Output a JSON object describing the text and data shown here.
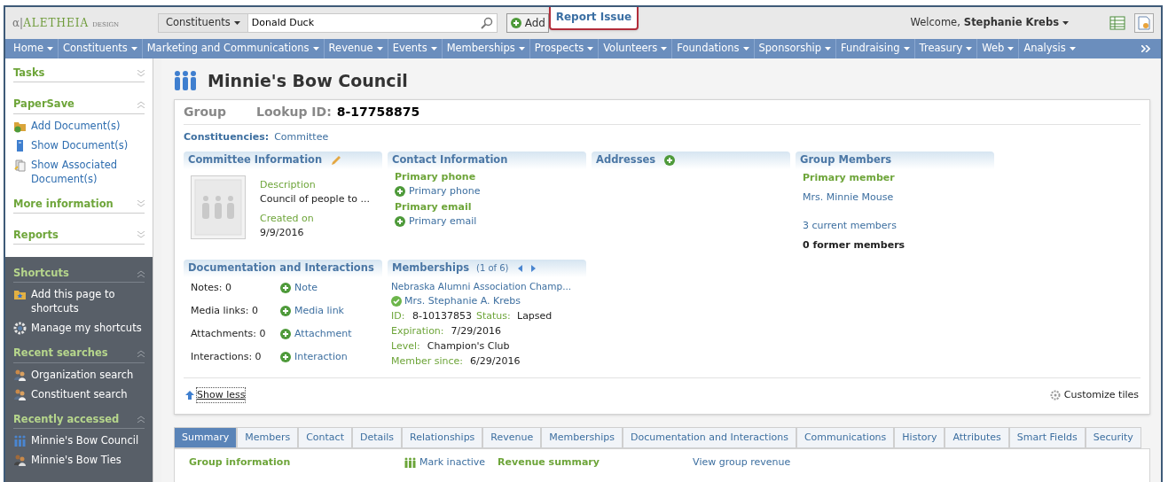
{
  "header": {
    "logo_mark": "α|",
    "logo_name": "ALETHEIA",
    "logo_tag": "DESIGN",
    "search_scope": "Constituents",
    "search_value": "Donald Duck",
    "add_button": "Add",
    "report_issue": "Report Issue",
    "welcome": "Welcome,",
    "user": "Stephanie Krebs"
  },
  "nav": [
    "Home",
    "Constituents",
    "Marketing and Communications",
    "Revenue",
    "Events",
    "Memberships",
    "Prospects",
    "Volunteers",
    "Foundations",
    "Sponsorship",
    "Fundraising",
    "Treasury",
    "Web",
    "Analysis"
  ],
  "sidebar": [
    {
      "title": "Tasks",
      "kind": "light",
      "expanded": false
    },
    {
      "title": "PaperSave",
      "kind": "light",
      "expanded": true,
      "items": [
        {
          "label": "Add Document(s)",
          "kind": "add"
        },
        {
          "label": "Show Document(s)",
          "kind": "document"
        },
        {
          "label": "Show Associated Document(s)",
          "kind": "documents"
        }
      ]
    },
    {
      "title": "More information",
      "kind": "light",
      "expanded": false
    },
    {
      "title": "Reports",
      "kind": "light",
      "expanded": false
    },
    {
      "title": "Shortcuts",
      "kind": "dark",
      "expanded": true,
      "items": [
        {
          "label": "Add this page to shortcuts",
          "kind": "shortcut"
        },
        {
          "label": "Manage my shortcuts",
          "kind": "settings"
        }
      ]
    },
    {
      "title": "Recent searches",
      "kind": "dark",
      "expanded": true,
      "items": [
        {
          "label": "Organization search",
          "kind": "search"
        },
        {
          "label": "Constituent search",
          "kind": "search"
        }
      ]
    },
    {
      "title": "Recently accessed",
      "kind": "dark",
      "expanded": true,
      "items": [
        {
          "label": "Minnie's Bow Council",
          "kind": "group"
        },
        {
          "label": "Minnie's Bow Ties",
          "kind": "organization"
        }
      ]
    }
  ],
  "record": {
    "title": "Minnie's Bow Council",
    "type": "Group",
    "lookup_label": "Lookup ID:",
    "lookup_id": "8-17758875",
    "constituencies_label": "Constituencies:",
    "constituencies": "Committee"
  },
  "tiles": [
    {
      "kind": "committee",
      "title": "Committee Information",
      "editable": true,
      "description_label": "Description",
      "description": "Council of people to ...",
      "created_label": "Created on",
      "created": "9/9/2016"
    },
    {
      "kind": "contact",
      "title": "Contact Information",
      "rows": [
        {
          "label": "Primary phone",
          "action": "Primary phone"
        },
        {
          "label": "Primary email",
          "action": "Primary email"
        }
      ]
    },
    {
      "kind": "addresses",
      "title": "Addresses"
    },
    {
      "kind": "members",
      "title": "Group Members",
      "primary_label": "Primary member",
      "primary": "Mrs. Minnie Mouse",
      "current": "3 current members",
      "former": "0 former members"
    },
    {
      "kind": "documentation",
      "title": "Documentation and Interactions",
      "rows": [
        {
          "label": "Notes: 0",
          "action": "Note"
        },
        {
          "label": "Media links: 0",
          "action": "Media link"
        },
        {
          "label": "Attachments: 0",
          "action": "Attachment"
        },
        {
          "label": "Interactions: 0",
          "action": "Interaction"
        }
      ]
    },
    {
      "kind": "membership",
      "title": "Memberships",
      "counter": "(1 of 6)",
      "program": "Nebraska Alumni Association Champ...",
      "member": "Mrs. Stephanie A. Krebs",
      "id_label": "ID:",
      "id": "8-10137853",
      "status_label": "Status:",
      "status": "Lapsed",
      "fields": [
        {
          "label": "Expiration:",
          "value": "7/29/2016"
        },
        {
          "label": "Level:",
          "value": "Champion's Club"
        },
        {
          "label": "Member since:",
          "value": "6/29/2016"
        }
      ]
    }
  ],
  "show_less": "Show less",
  "customize": "Customize tiles",
  "tabs": [
    {
      "label": "Summary",
      "selected": true
    },
    {
      "label": "Members",
      "selected": false
    },
    {
      "label": "Contact",
      "selected": false
    },
    {
      "label": "Details",
      "selected": false
    },
    {
      "label": "Relationships",
      "selected": false
    },
    {
      "label": "Revenue",
      "selected": false
    },
    {
      "label": "Memberships",
      "selected": false
    },
    {
      "label": "Documentation and Interactions",
      "selected": false
    },
    {
      "label": "Communications",
      "selected": false
    },
    {
      "label": "History",
      "selected": false
    },
    {
      "label": "Attributes",
      "selected": false
    },
    {
      "label": "Smart Fields",
      "selected": false
    },
    {
      "label": "Security",
      "selected": false
    }
  ],
  "summary": {
    "group_heading": "Group information",
    "mark_inactive": "Mark inactive",
    "revenue_heading": "Revenue summary",
    "view_revenue": "View group revenue"
  }
}
